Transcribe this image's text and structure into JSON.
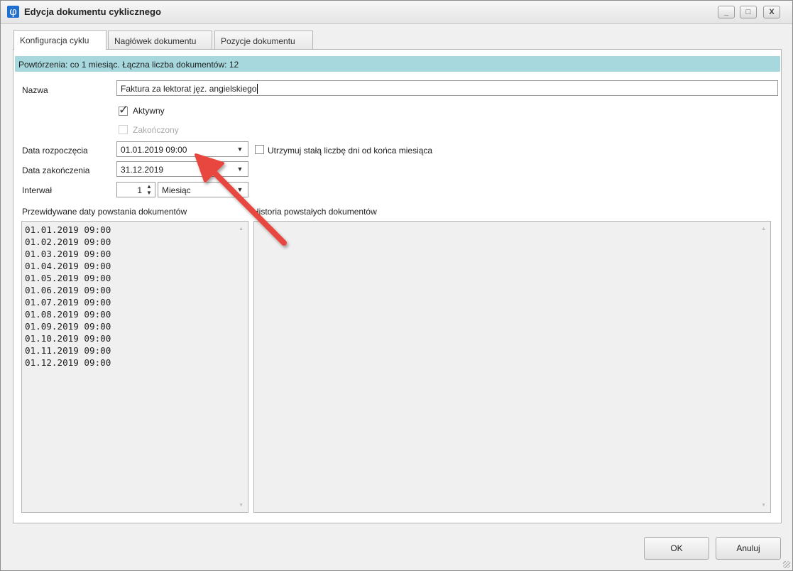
{
  "window": {
    "title": "Edycja dokumentu cyklicznego",
    "controls": [
      "_",
      "□",
      "X"
    ]
  },
  "tabs": [
    {
      "label": "Konfiguracja cyklu",
      "active": true
    },
    {
      "label": "Nagłówek dokumentu",
      "active": false
    },
    {
      "label": "Pozycje dokumentu",
      "active": false
    }
  ],
  "info_bar": "Powtórzenia: co 1 miesiąc. Łączna liczba dokumentów: 12",
  "form": {
    "name_label": "Nazwa",
    "name_value": "Faktura za lektorat jęz. angielskiego",
    "active_label": "Aktywny",
    "active_checked": true,
    "finished_label": "Zakończony",
    "finished_checked": false,
    "start_label": "Data rozpoczęcia",
    "start_value": "01.01.2019 09:00",
    "keep_days_label": "Utrzymuj stałą liczbę dni od końca miesiąca",
    "keep_days_checked": false,
    "end_label": "Data zakończenia",
    "end_value": "31.12.2019",
    "interval_label": "Interwał",
    "interval_value": "1",
    "interval_unit": "Miesiąc"
  },
  "predicted": {
    "label": "Przewidywane daty powstania dokumentów",
    "dates": [
      "01.01.2019 09:00",
      "01.02.2019 09:00",
      "01.03.2019 09:00",
      "01.04.2019 09:00",
      "01.05.2019 09:00",
      "01.06.2019 09:00",
      "01.07.2019 09:00",
      "01.08.2019 09:00",
      "01.09.2019 09:00",
      "01.10.2019 09:00",
      "01.11.2019 09:00",
      "01.12.2019 09:00"
    ]
  },
  "history": {
    "label": "Historia powstałych dokumentów",
    "items": []
  },
  "buttons": {
    "ok": "OK",
    "cancel": "Anuluj"
  },
  "colors": {
    "info_bar": "#a6d8dd",
    "annotation_arrow": "#e8473f",
    "app_icon": "#1f6fd1"
  }
}
